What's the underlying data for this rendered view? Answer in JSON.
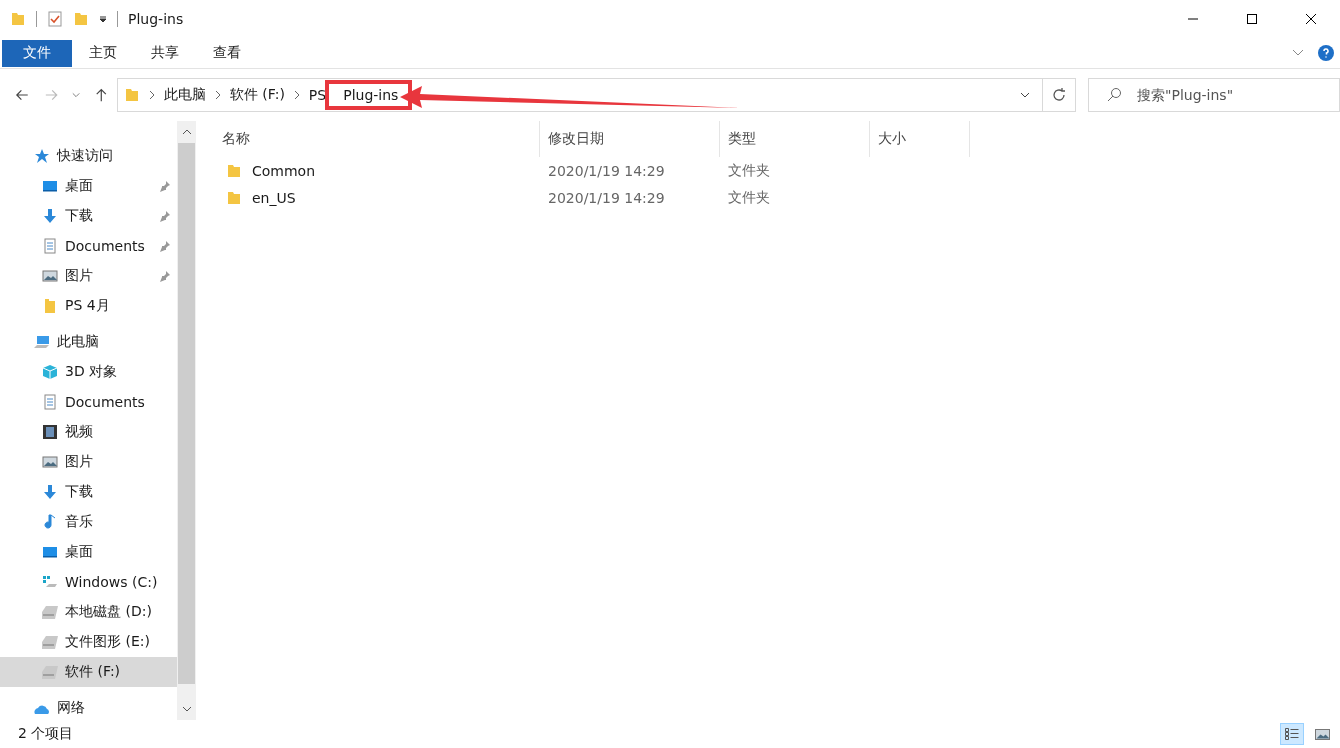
{
  "window": {
    "title": "Plug-ins"
  },
  "ribbon": {
    "file_menu": "文件",
    "tabs": [
      {
        "label": "主页",
        "selected": false
      },
      {
        "label": "共享",
        "selected": false
      },
      {
        "label": "查看",
        "selected": false
      }
    ]
  },
  "address_bar": {
    "crumbs": [
      "此电脑",
      "软件 (F:)",
      "PS",
      "Plug-ins"
    ]
  },
  "search": {
    "placeholder": "搜索\"Plug-ins\""
  },
  "navigation": [
    {
      "label": "快速访问",
      "kind": "star",
      "selected": false,
      "children": [
        {
          "label": "桌面",
          "kind": "desktop",
          "pinned": true,
          "selected": false
        },
        {
          "label": "下载",
          "kind": "download",
          "pinned": true,
          "selected": false
        },
        {
          "label": "Documents",
          "kind": "document",
          "pinned": true,
          "selected": false
        },
        {
          "label": "图片",
          "kind": "picture",
          "pinned": true,
          "selected": false
        },
        {
          "label": "PS 4月",
          "kind": "folder",
          "pinned": false,
          "selected": false
        }
      ]
    },
    {
      "label": "此电脑",
      "kind": "computer",
      "selected": false,
      "children": [
        {
          "label": "3D 对象",
          "kind": "cube",
          "pinned": false,
          "selected": false
        },
        {
          "label": "Documents",
          "kind": "document",
          "pinned": false,
          "selected": false
        },
        {
          "label": "视频",
          "kind": "video",
          "pinned": false,
          "selected": false
        },
        {
          "label": "图片",
          "kind": "picture",
          "pinned": false,
          "selected": false
        },
        {
          "label": "下载",
          "kind": "download",
          "pinned": false,
          "selected": false
        },
        {
          "label": "音乐",
          "kind": "music",
          "pinned": false,
          "selected": false
        },
        {
          "label": "桌面",
          "kind": "desktop",
          "pinned": false,
          "selected": false
        },
        {
          "label": "Windows (C:)",
          "kind": "windows-drive",
          "pinned": false,
          "selected": false
        },
        {
          "label": "本地磁盘 (D:)",
          "kind": "drive",
          "pinned": false,
          "selected": false
        },
        {
          "label": "文件图形 (E:)",
          "kind": "drive",
          "pinned": false,
          "selected": false
        },
        {
          "label": "软件 (F:)",
          "kind": "drive",
          "pinned": false,
          "selected": true
        }
      ]
    },
    {
      "label": "网络",
      "kind": "network",
      "selected": false
    }
  ],
  "table": {
    "columns": [
      "名称",
      "修改日期",
      "类型",
      "大小"
    ],
    "rows": [
      {
        "name": "Common",
        "modified": "2020/1/19 14:29",
        "type": "文件夹"
      },
      {
        "name": "en_US",
        "modified": "2020/1/19 14:29",
        "type": "文件夹"
      }
    ]
  },
  "status_bar": {
    "count": "2 个项目",
    "view_buttons": [
      {
        "kind": "details",
        "selected": true
      },
      {
        "kind": "thumbnails",
        "selected": false
      }
    ]
  }
}
